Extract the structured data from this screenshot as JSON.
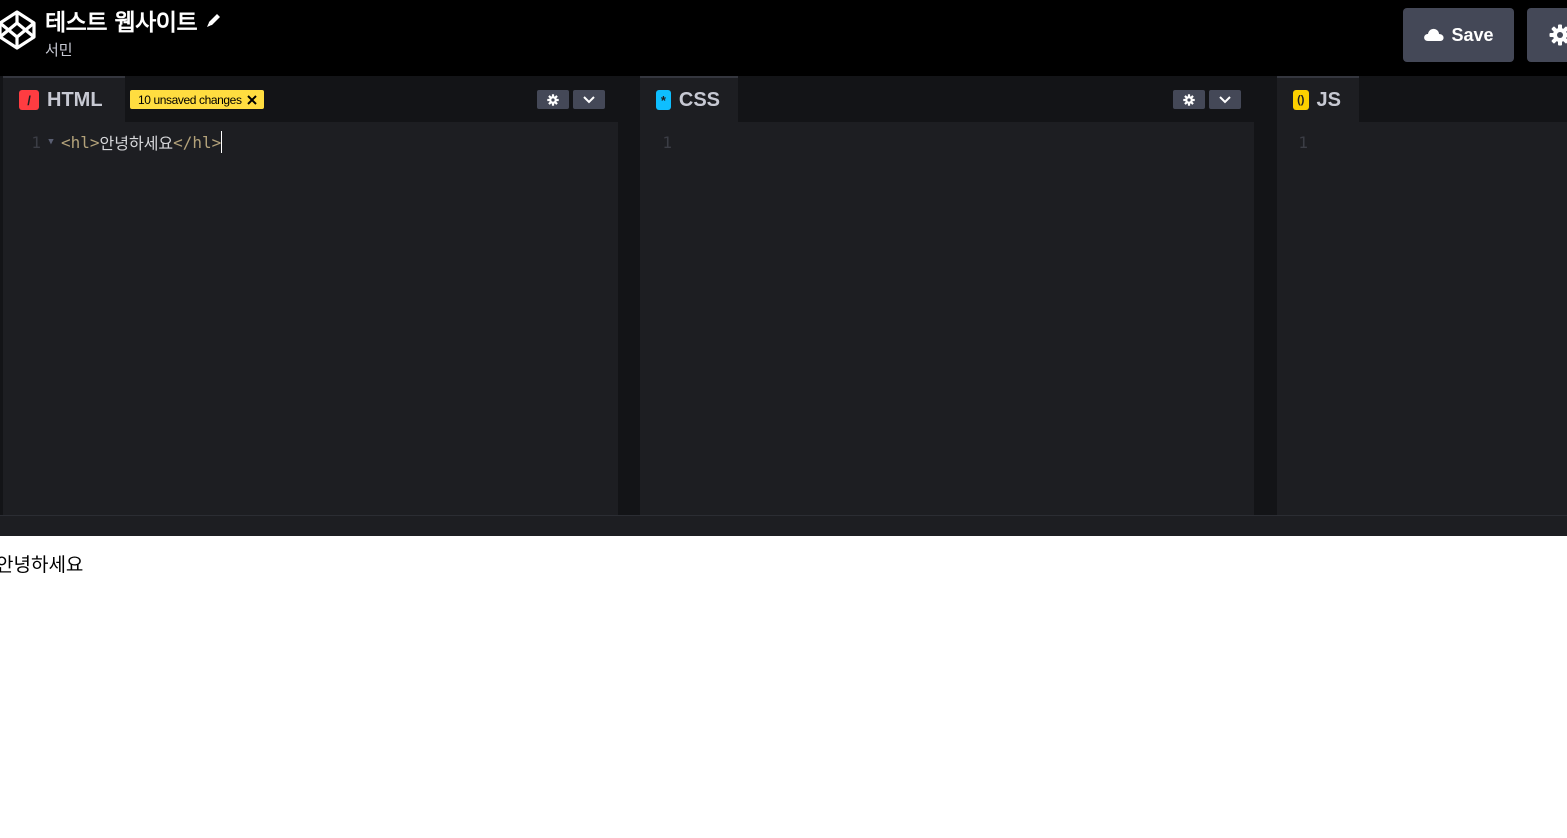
{
  "header": {
    "title": "테스트 웹사이트",
    "author": "서민",
    "save_label": "Save",
    "icons": {
      "logo": "codepen-logo-icon",
      "edit": "pencil-icon",
      "save": "cloud-icon",
      "settings": "gear-icon"
    }
  },
  "editors": [
    {
      "label": "HTML",
      "icon_glyph": "/",
      "icon_color": "#ff3c41",
      "badge": "10 unsaved changes",
      "lines": [
        {
          "number": "1",
          "open_tag": "<hl>",
          "text": "안녕하세요",
          "close_tag": "</hl>"
        }
      ]
    },
    {
      "label": "CSS",
      "icon_glyph": "*",
      "icon_color": "#0ebeff",
      "lines": [
        {
          "number": "1"
        }
      ]
    },
    {
      "label": "JS",
      "icon_glyph": "()",
      "icon_color": "#fcd000",
      "lines": [
        {
          "number": "1"
        }
      ]
    }
  ],
  "preview": {
    "text": "안녕하세요"
  },
  "colors": {
    "accent_badge": "#ffdd40",
    "button_bg": "#444857",
    "editor_bg": "#1d1e22"
  }
}
